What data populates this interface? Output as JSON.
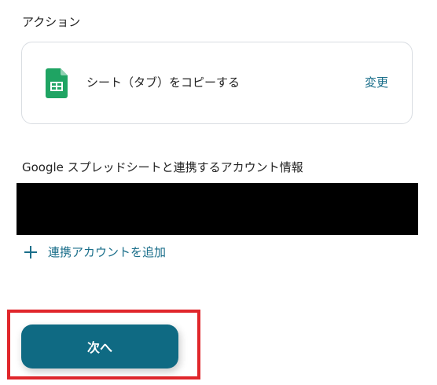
{
  "action_section": {
    "label": "アクション",
    "card": {
      "app_icon": "google-sheets-icon",
      "action_name": "シート（タブ）をコピーする",
      "change_label": "変更"
    }
  },
  "account_section": {
    "label": "Google スプレッドシートと連携するアカウント情報",
    "add_account_label": "連携アカウントを追加"
  },
  "footer": {
    "next_label": "次へ"
  },
  "colors": {
    "accent": "#1a6e8a",
    "button": "#0f6a83",
    "highlight": "#e0262b",
    "sheets_green": "#1fa463"
  }
}
